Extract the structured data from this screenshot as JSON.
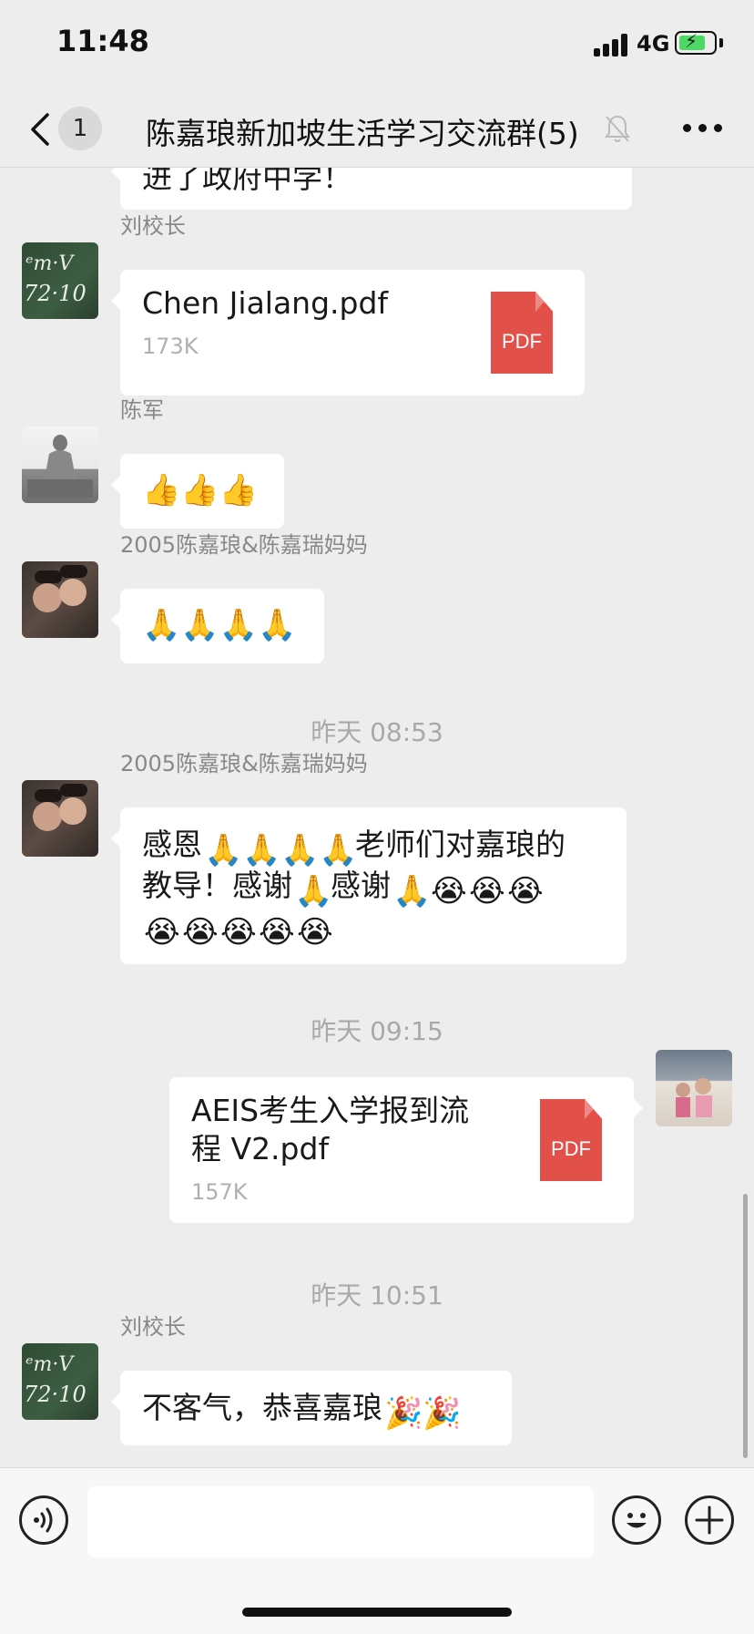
{
  "status": {
    "time": "11:48",
    "network": "4G"
  },
  "nav": {
    "unread": "1",
    "title": "陈嘉琅新加坡生活学习交流群(5)"
  },
  "messages": {
    "partial_text": "进了政府中学！",
    "m1": {
      "sender": "刘校长",
      "file_name": "Chen Jialang.pdf",
      "file_size": "173K",
      "file_icon": "PDF"
    },
    "m2": {
      "sender": "陈军",
      "emojis": "👍👍👍"
    },
    "m3": {
      "sender": "2005陈嘉琅&陈嘉瑞妈妈",
      "emojis": "🙏🙏🙏🙏"
    },
    "ts1": "昨天 08:53",
    "m4": {
      "sender": "2005陈嘉琅&陈嘉瑞妈妈",
      "line1_a": "感恩",
      "line1_b": "老师们对嘉琅的",
      "line2_a": "教导！感谢",
      "line2_b": "感谢",
      "emoji_pray": "🙏",
      "emoji_cry": "😭"
    },
    "ts2": "昨天 09:15",
    "m5": {
      "file_name_1": "AEIS考生入学报到流",
      "file_name_2": "程 V2.pdf",
      "file_size": "157K",
      "file_icon": "PDF"
    },
    "ts3": "昨天 10:51",
    "m6": {
      "sender": "刘校长",
      "text": "不客气，恭喜嘉琅",
      "emoji": "🎉"
    }
  },
  "input": {
    "value": ""
  }
}
